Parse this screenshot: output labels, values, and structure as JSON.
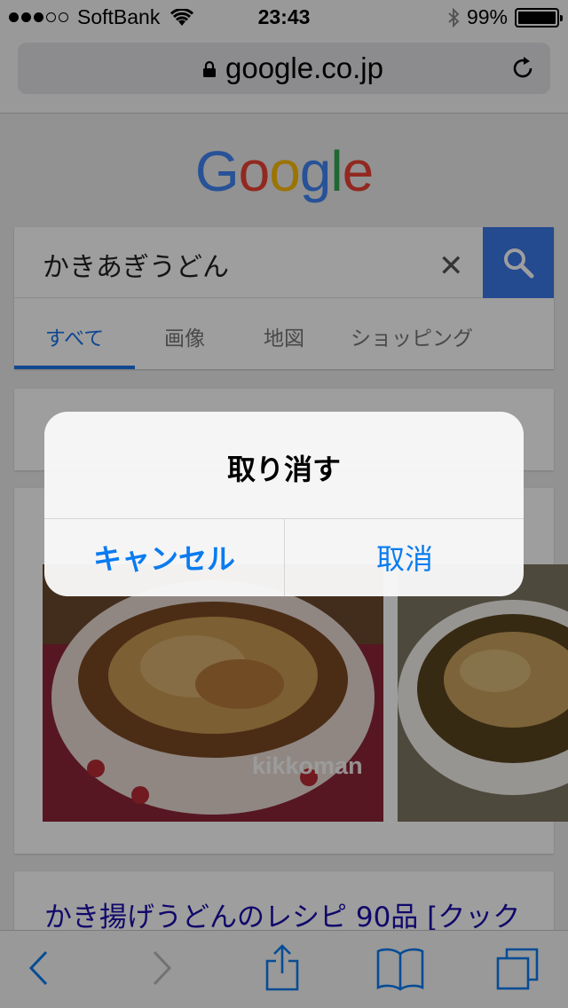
{
  "status_bar": {
    "carrier": "SoftBank",
    "time": "23:43",
    "battery": "99%",
    "battery_level": 0.99
  },
  "browser": {
    "url": "google.co.jp"
  },
  "google": {
    "logo_letters": [
      "G",
      "o",
      "o",
      "g",
      "l",
      "e"
    ],
    "logo_colors": [
      "#4285f4",
      "#ea4335",
      "#fbbc05",
      "#4285f4",
      "#34a853",
      "#ea4335"
    ],
    "search_query": "かきあぎうどん",
    "tabs": [
      "すべて",
      "画像",
      "地図",
      "ショッピング"
    ],
    "active_tab": "すべて",
    "image_watermark": "kikkoman",
    "result_title": "かき揚げうどんのレシピ 90品 [クック"
  },
  "dialog": {
    "title": "取り消す",
    "cancel_label": "キャンセル",
    "confirm_label": "取消"
  },
  "toolbar_icons": [
    "back-icon",
    "forward-icon",
    "share-icon",
    "bookmarks-icon",
    "tabs-icon"
  ],
  "colors": {
    "accent": "#0a7bf0",
    "search_blue": "#3b78e7",
    "link": "#1a0dab"
  }
}
